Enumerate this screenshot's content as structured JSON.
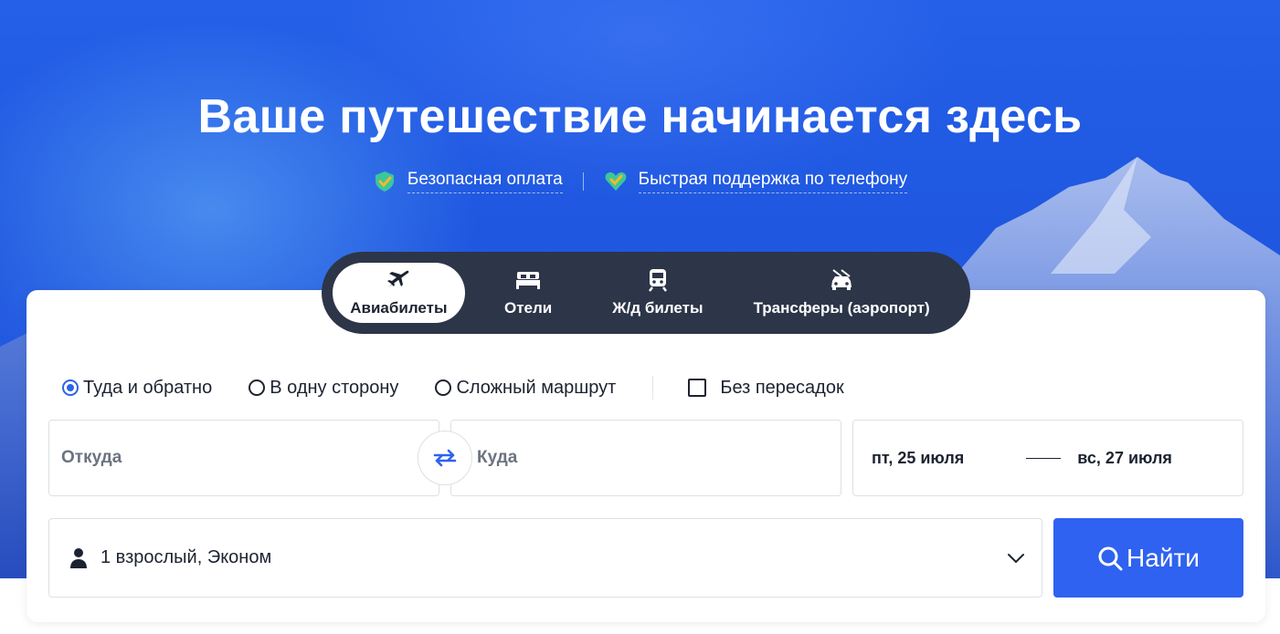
{
  "hero": {
    "title": "Ваше путешествие начинается здесь",
    "badges": [
      {
        "icon": "shield-check-icon",
        "label": "Безопасная оплата"
      },
      {
        "icon": "heart-check-icon",
        "label": "Быстрая поддержка по телефону"
      }
    ]
  },
  "tabs": [
    {
      "icon": "plane-icon",
      "label": "Авиабилеты",
      "active": true
    },
    {
      "icon": "bed-icon",
      "label": "Отели",
      "active": false
    },
    {
      "icon": "train-icon",
      "label": "Ж/д билеты",
      "active": false
    },
    {
      "icon": "car-icon",
      "label": "Трансферы (аэропорт)",
      "active": false
    }
  ],
  "trip_options": {
    "round_trip": "Туда и обратно",
    "one_way": "В одну сторону",
    "multi_city": "Сложный маршрут",
    "selected": "round_trip",
    "direct_only": "Без пересадок",
    "direct_only_checked": false
  },
  "search": {
    "from_placeholder": "Откуда",
    "to_placeholder": "Куда",
    "depart_date": "пт, 25 июля",
    "return_date": "вс, 27 июля",
    "passengers": "1 взрослый, Эконом",
    "search_button": "Найти"
  },
  "colors": {
    "accent": "#2f62f0",
    "tabs_bg": "#2d3548",
    "hero_bg": "#2460e8"
  }
}
